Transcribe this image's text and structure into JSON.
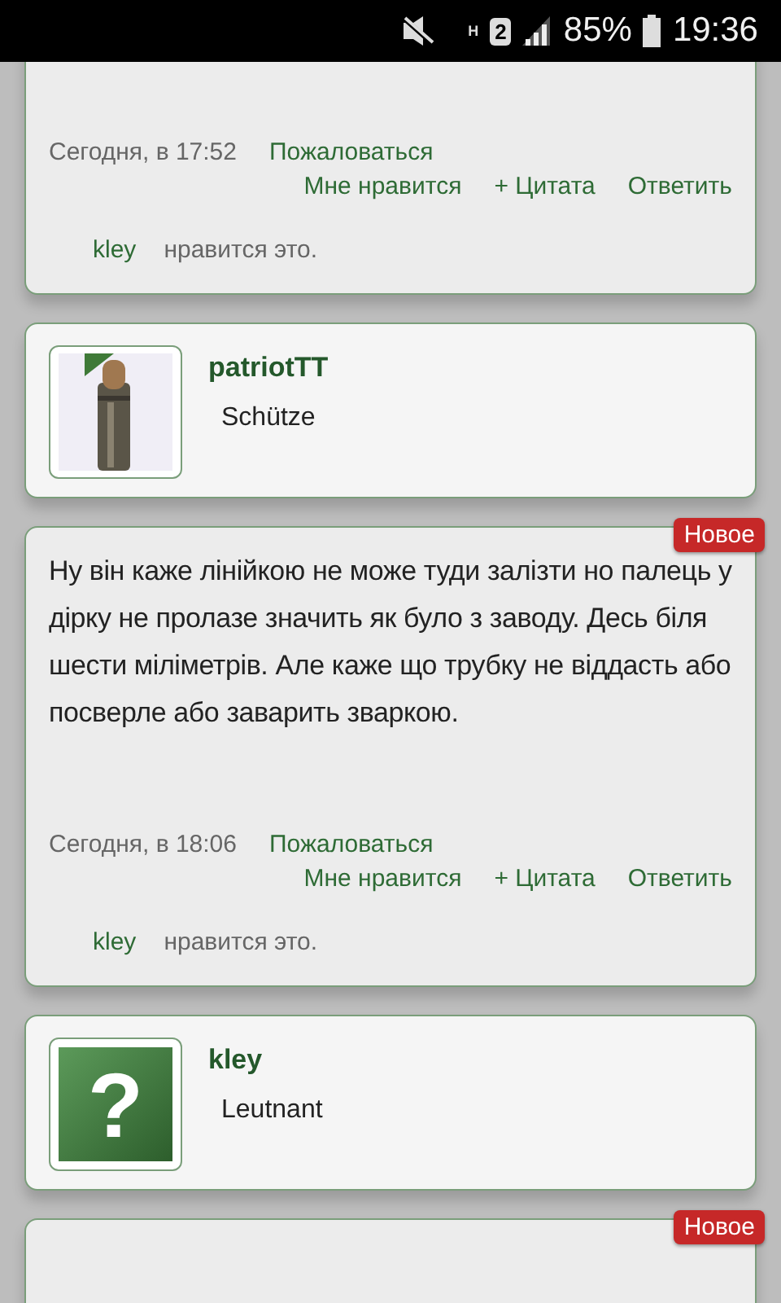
{
  "status_bar": {
    "network": "H",
    "sim": "2",
    "battery": "85%",
    "time": "19:36"
  },
  "blocks": [
    {
      "kind": "post",
      "date": "Сегодня, в 17:52",
      "report": "Пожаловаться",
      "actions": [
        "Мне нравится",
        "+ Цитата",
        "Ответить"
      ],
      "likes": {
        "user": "kley",
        "text": "нравится это."
      }
    },
    {
      "kind": "author",
      "name": "patriotTT",
      "rank": "Schütze"
    },
    {
      "kind": "post",
      "badge": "Новое",
      "text": "Ну він каже лінійкою не може туди залізти но палець у дірку не пролазе значить як було з заводу. Десь біля шести міліметрів. Але каже що трубку не віддасть або посверле або заварить зваркою.",
      "date": "Сегодня, в 18:06",
      "report": "Пожаловаться",
      "actions": [
        "Мне нравится",
        "+ Цитата",
        "Ответить"
      ],
      "likes": {
        "user": "kley",
        "text": "нравится это."
      }
    },
    {
      "kind": "author",
      "avatar": {
        "kind": "glyph",
        "glyph": "?"
      },
      "name": "kley",
      "rank": "Leutnant"
    },
    {
      "kind": "post",
      "badge": "Новое"
    }
  ]
}
